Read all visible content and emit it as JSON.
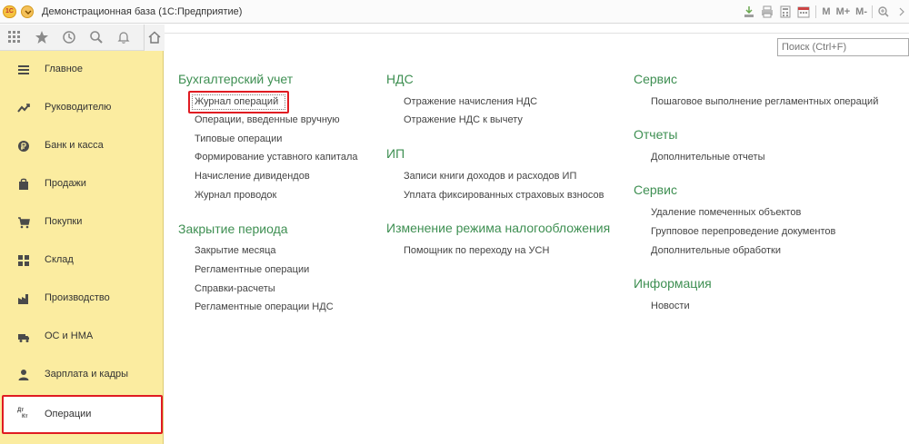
{
  "window": {
    "app_title": "Демонстрационная база  (1С:Предприятие)",
    "logo_text": "1С",
    "toolbar_m_labels": [
      "M",
      "M+",
      "M-"
    ]
  },
  "search": {
    "placeholder": "Поиск (Ctrl+F)"
  },
  "sidebar": {
    "items": [
      {
        "label": "Главное",
        "icon": "hamburger-icon"
      },
      {
        "label": "Руководителю",
        "icon": "trend-icon"
      },
      {
        "label": "Банк и касса",
        "icon": "coin-icon"
      },
      {
        "label": "Продажи",
        "icon": "bag-icon"
      },
      {
        "label": "Покупки",
        "icon": "cart-icon"
      },
      {
        "label": "Склад",
        "icon": "grid-icon"
      },
      {
        "label": "Производство",
        "icon": "factory-icon"
      },
      {
        "label": "ОС и НМА",
        "icon": "truck-icon"
      },
      {
        "label": "Зарплата и кадры",
        "icon": "person-icon"
      },
      {
        "label": "Операции",
        "icon": "dt-kt-icon",
        "active": true
      }
    ],
    "dt_kt_text": [
      "Дт",
      "Кт"
    ]
  },
  "columns": {
    "col1": {
      "sections": [
        {
          "title": "Бухгалтерский учет",
          "links": [
            "Журнал операций",
            "Операции, введенные вручную",
            "Типовые операции",
            "Формирование уставного капитала",
            "Начисление дивидендов",
            "Журнал проводок"
          ]
        },
        {
          "title": "Закрытие периода",
          "links": [
            "Закрытие месяца",
            "Регламентные операции",
            "Справки-расчеты",
            "Регламентные операции НДС"
          ]
        }
      ]
    },
    "col2": {
      "sections": [
        {
          "title": "НДС",
          "links": [
            "Отражение начисления НДС",
            "Отражение НДС к вычету"
          ]
        },
        {
          "title": "ИП",
          "links": [
            "Записи книги доходов и расходов ИП",
            "Уплата фиксированных страховых взносов"
          ]
        },
        {
          "title": "Изменение режима налогообложения",
          "links": [
            "Помощник по переходу на УСН"
          ]
        }
      ]
    },
    "col3": {
      "sections": [
        {
          "title": "Сервис",
          "links": [
            "Пошаговое выполнение регламентных операций"
          ]
        },
        {
          "title": "Отчеты",
          "links": [
            "Дополнительные отчеты"
          ]
        },
        {
          "title": "Сервис",
          "links": [
            "Удаление помеченных объектов",
            "Групповое перепроведение документов",
            "Дополнительные обработки"
          ]
        },
        {
          "title": "Информация",
          "links": [
            "Новости"
          ]
        }
      ]
    }
  },
  "colors": {
    "sidebar_bg": "#fbeca0",
    "section_heading": "#3e8f52",
    "highlight_border": "#e01b22"
  }
}
